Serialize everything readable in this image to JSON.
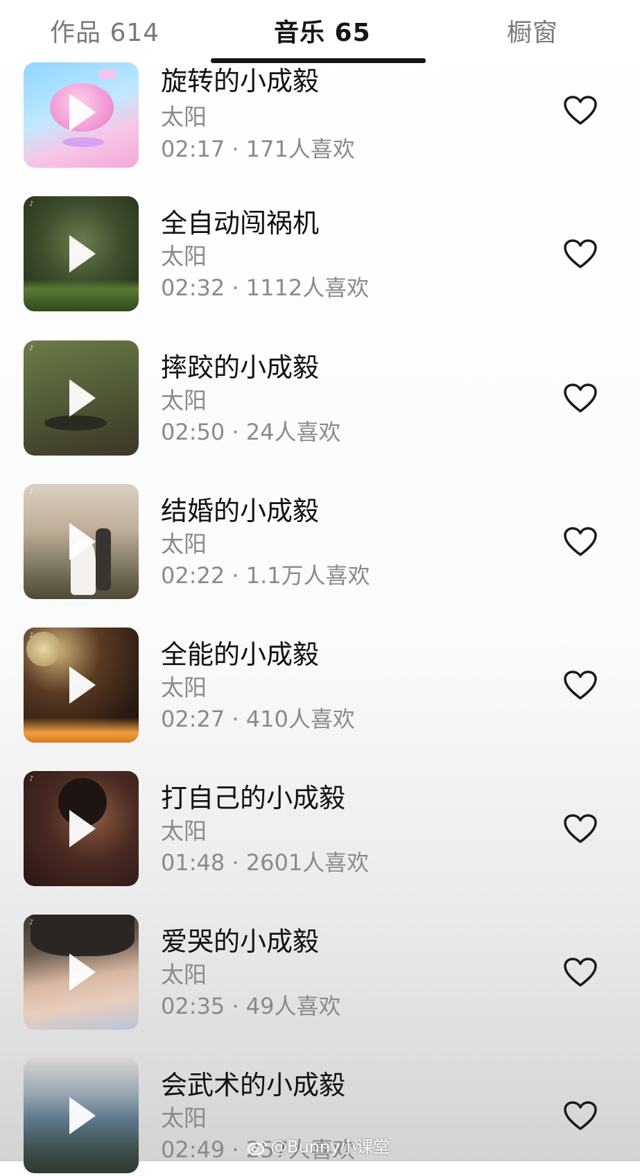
{
  "tabs": {
    "works": "作品 614",
    "music": "音乐 65",
    "shop": "橱窗"
  },
  "songs": [
    {
      "title": "旋转的小成毅",
      "artist": "太阳",
      "meta": "02:17 · 171人喜欢",
      "heart_icon": "heart-outline-icon"
    },
    {
      "title": "全自动闯祸机",
      "artist": "太阳",
      "meta": "02:32 · 1112人喜欢",
      "heart_icon": "heart-outline-icon"
    },
    {
      "title": "摔跤的小成毅",
      "artist": "太阳",
      "meta": "02:50 · 24人喜欢",
      "heart_icon": "heart-outline-icon"
    },
    {
      "title": "结婚的小成毅",
      "artist": "太阳",
      "meta": "02:22 · 1.1万人喜欢",
      "heart_icon": "heart-outline-icon"
    },
    {
      "title": "全能的小成毅",
      "artist": "太阳",
      "meta": "02:27 · 410人喜欢",
      "heart_icon": "heart-outline-icon"
    },
    {
      "title": "打自己的小成毅",
      "artist": "太阳",
      "meta": "01:48 · 2601人喜欢",
      "heart_icon": "heart-outline-icon"
    },
    {
      "title": "爱哭的小成毅",
      "artist": "太阳",
      "meta": "02:35 · 49人喜欢",
      "heart_icon": "heart-outline-icon"
    },
    {
      "title": "会武术的小成毅",
      "artist": "太阳",
      "meta": "02:49 · 257人喜欢",
      "heart_icon": "heart-outline-icon"
    }
  ],
  "watermark": "@Bunny小课堂",
  "colors": {
    "active_tab": "#161616",
    "inactive_tab": "#7a7a7a",
    "secondary_text": "#8a8a8a"
  }
}
